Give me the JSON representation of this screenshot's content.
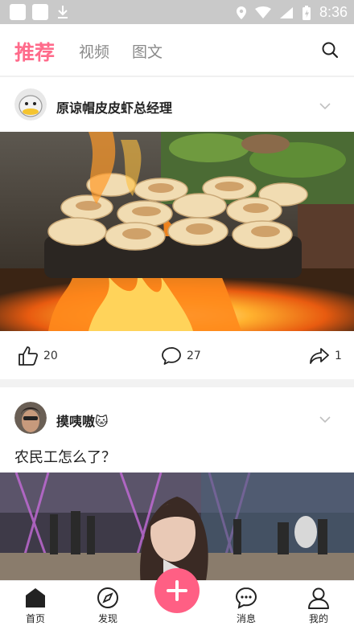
{
  "status_bar": {
    "time": "8:36"
  },
  "top_nav": {
    "tabs": [
      {
        "label": "推荐",
        "active": true
      },
      {
        "label": "视频",
        "active": false
      },
      {
        "label": "图文",
        "active": false
      }
    ]
  },
  "posts": [
    {
      "username": "原谅帽皮皮虾总经理",
      "likes": "20",
      "comments": "27",
      "shares": "1"
    },
    {
      "username": "摸咦嗷🐱",
      "caption": "农民工怎么了？"
    }
  ],
  "bottom_nav": {
    "items": [
      {
        "label": "首页"
      },
      {
        "label": "发现"
      },
      {
        "label": "消息"
      },
      {
        "label": "我的"
      }
    ]
  },
  "colors": {
    "accent": "#ff6b8b",
    "plus_button": "#ff5f84"
  }
}
